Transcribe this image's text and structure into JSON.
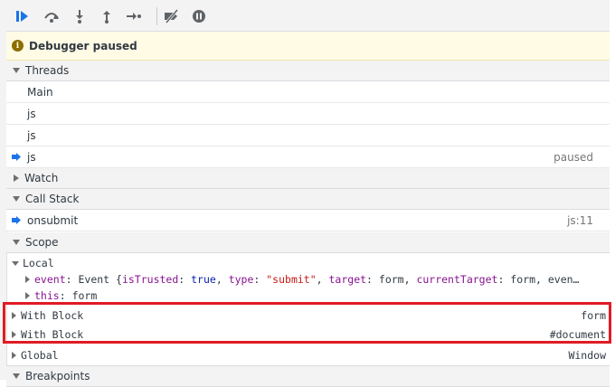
{
  "toolbar": {
    "buttons": [
      {
        "icon": "resume-icon",
        "color": "#1a73e8"
      },
      {
        "icon": "step-over-icon",
        "color": "#5f6368"
      },
      {
        "icon": "step-into-icon",
        "color": "#5f6368"
      },
      {
        "icon": "step-out-icon",
        "color": "#5f6368"
      },
      {
        "icon": "step-icon",
        "color": "#5f6368"
      },
      {
        "icon": "deactivate-breakpoints-icon",
        "color": "#5f6368"
      },
      {
        "icon": "pause-on-exceptions-icon",
        "color": "#5f6368"
      }
    ]
  },
  "banner": {
    "text": "Debugger paused",
    "color": "#fffbe5"
  },
  "threads": {
    "title": "Threads",
    "items": [
      {
        "name": "Main",
        "status": ""
      },
      {
        "name": "js",
        "status": ""
      },
      {
        "name": "js",
        "status": ""
      },
      {
        "name": "js",
        "status": "paused"
      }
    ]
  },
  "watch": {
    "title": "Watch"
  },
  "call_stack": {
    "title": "Call Stack",
    "frames": [
      {
        "name": "onsubmit",
        "location": "js:11"
      }
    ]
  },
  "scope": {
    "title": "Scope",
    "local": {
      "label": "Local",
      "event_key": "event",
      "event_value": "Event {isTrusted: true, type: \"submit\", target: form, currentTarget: form, even…",
      "this_key": "this",
      "this_value": "form"
    },
    "blocks": [
      {
        "label": "With Block",
        "value": "form"
      },
      {
        "label": "With Block",
        "value": "#document"
      }
    ],
    "global": {
      "label": "Global",
      "value": "Window"
    }
  },
  "breakpoints": {
    "title": "Breakpoints"
  },
  "colors": {
    "highlight": "#e01b24",
    "accent": "#1a73e8",
    "keyword": "#881391",
    "string": "#c41a16",
    "bool": "#0d22aa"
  }
}
